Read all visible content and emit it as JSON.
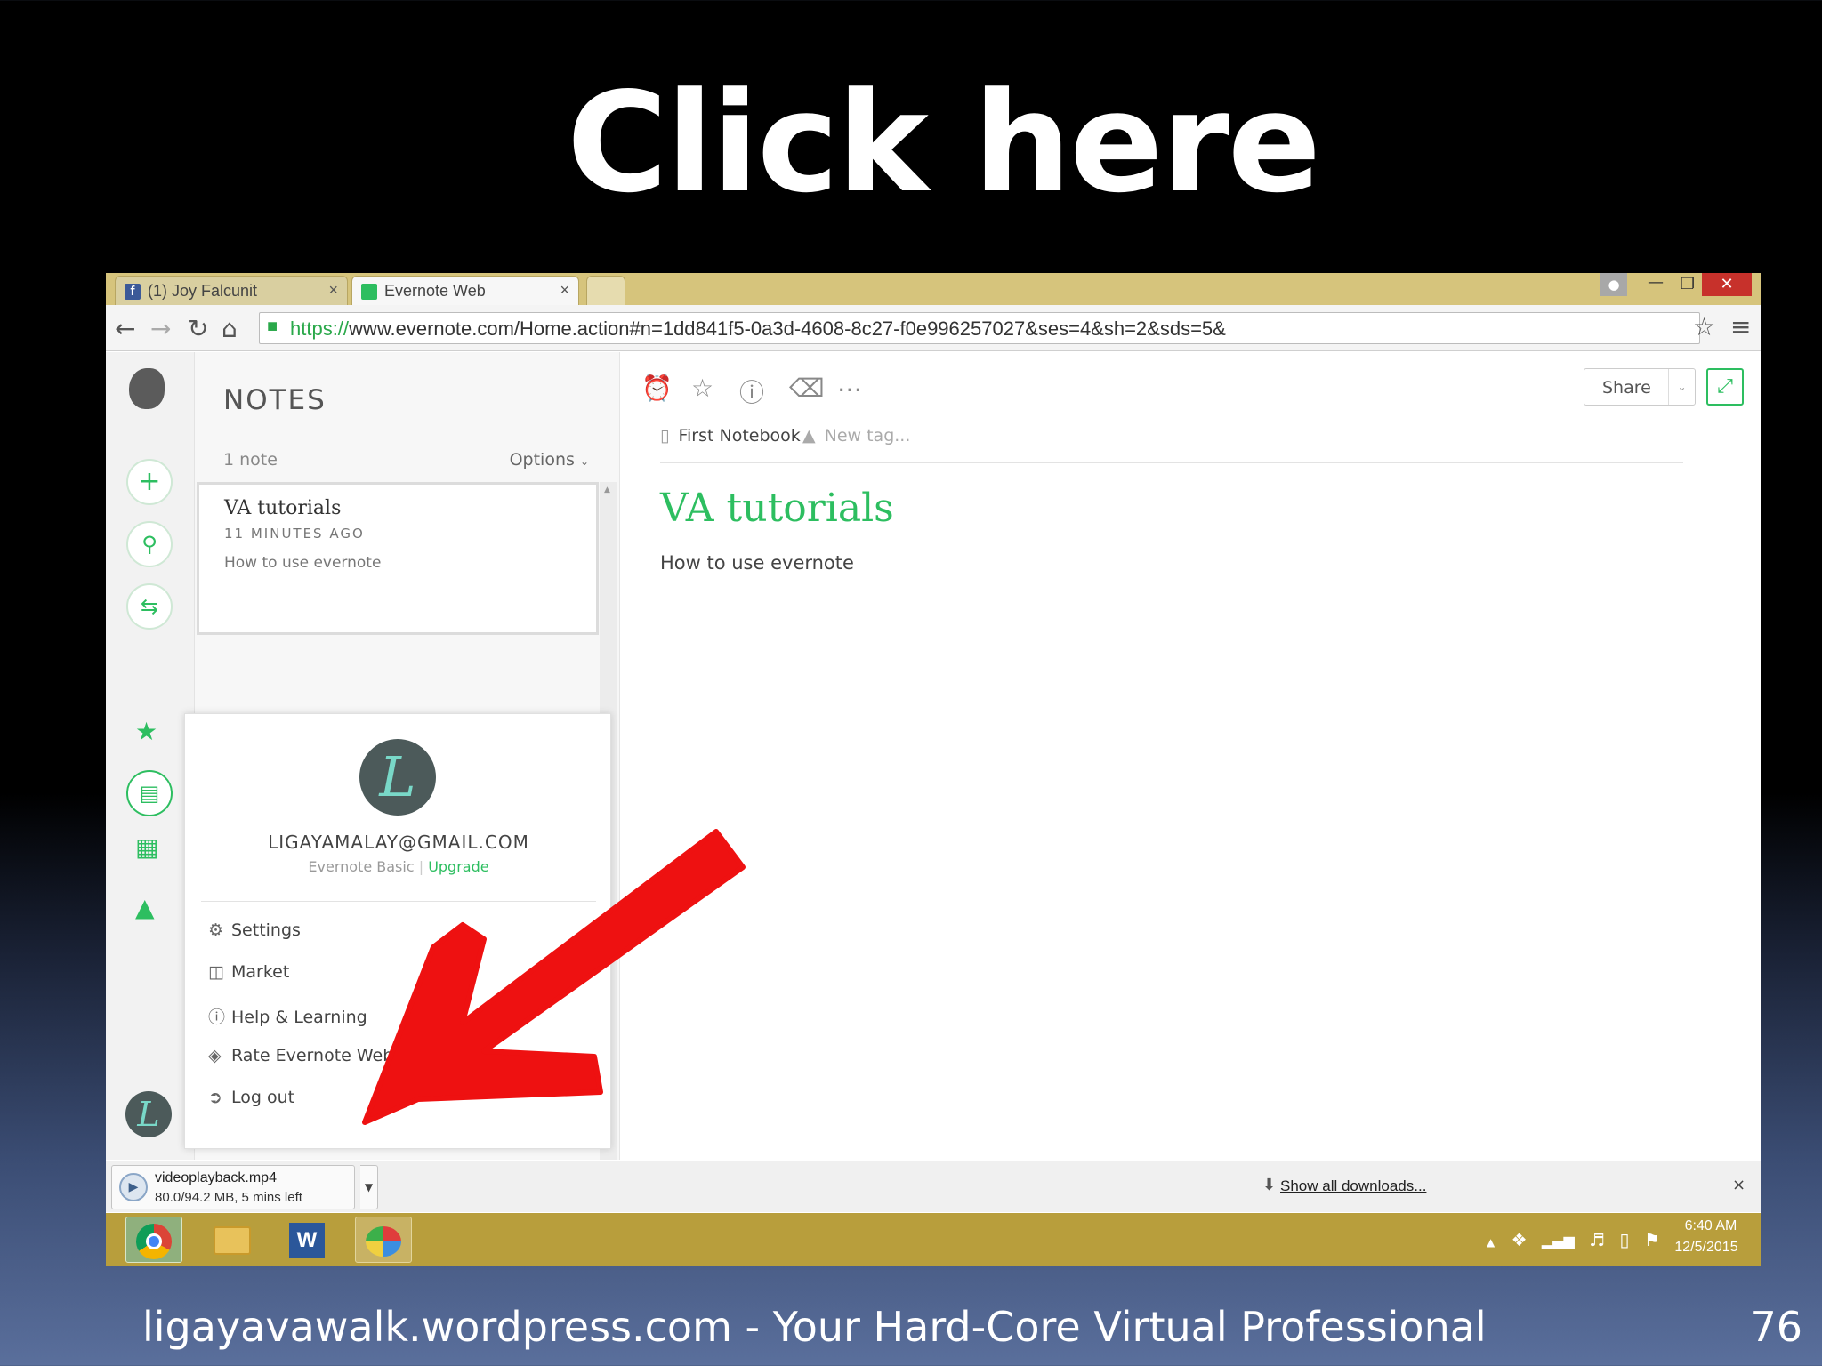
{
  "slide": {
    "title": "Click here",
    "footer": "ligayavawalk.wordpress.com - Your Hard-Core Virtual Professional",
    "page_number": "76"
  },
  "browser": {
    "tabs": [
      {
        "label": "(1) Joy Falcunit",
        "icon": "facebook-icon",
        "close": "×"
      },
      {
        "label": "Evernote Web",
        "icon": "evernote-icon",
        "close": "×"
      }
    ],
    "url_https": "https://",
    "url_rest": "www.evernote.com/Home.action#n=1dd841f5-0a3d-4608-8c27-f0e996257027&ses=4&sh=2&sds=5&"
  },
  "evernote": {
    "notes_title": "NOTES",
    "note_count": "1 note",
    "options_label": "Options",
    "note": {
      "title": "VA tutorials",
      "time": "11 MINUTES AGO",
      "snippet": "How to use evernote"
    },
    "editor": {
      "share_label": "Share",
      "notebook": "First Notebook",
      "new_tag": "New tag...",
      "title": "VA tutorials",
      "body": "How to use evernote"
    },
    "account_menu": {
      "avatar_letter": "L",
      "email": "LIGAYAMALAY@GMAIL.COM",
      "plan": "Evernote Basic",
      "upgrade": "Upgrade",
      "items": [
        {
          "label": "Settings",
          "icon": "gear-icon"
        },
        {
          "label": "Market",
          "icon": "shopping-bag-icon"
        },
        {
          "label": "Help & Learning",
          "icon": "help-circle-icon"
        },
        {
          "label": "Rate Evernote Web",
          "icon": "rate-icon"
        },
        {
          "label": "Log out",
          "icon": "logout-icon"
        }
      ]
    }
  },
  "downloads": {
    "file_name": "videoplayback.mp4",
    "status": "80.0/94.2 MB, 5 mins left",
    "show_all": "Show all downloads...",
    "close": "×"
  },
  "taskbar": {
    "time": "6:40 AM",
    "date": "12/5/2015"
  },
  "colors": {
    "accent_green": "#2dbe60",
    "annotation_arrow": "#ee1111"
  }
}
